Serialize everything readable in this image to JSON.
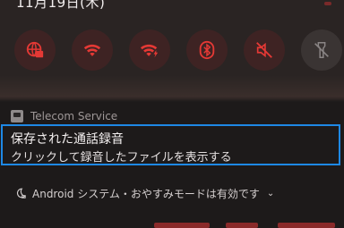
{
  "status": {
    "date": "11月19日(木)"
  },
  "quick_settings": {
    "tiles": [
      {
        "name": "ethernet",
        "state": "on",
        "icon": "ethernet-globe-icon",
        "color": "#e53935"
      },
      {
        "name": "wifi",
        "state": "on",
        "icon": "wifi-icon",
        "color": "#e53935"
      },
      {
        "name": "wifi-calling",
        "state": "on",
        "icon": "wifi-calling-icon",
        "color": "#e53935"
      },
      {
        "name": "bluetooth",
        "state": "on",
        "icon": "bluetooth-icon",
        "color": "#e53935"
      },
      {
        "name": "sound",
        "state": "on",
        "icon": "volume-muted-icon",
        "color": "#e53935"
      },
      {
        "name": "flashlight",
        "state": "off",
        "icon": "flashlight-off-icon",
        "color": "#8a8585"
      }
    ]
  },
  "notification": {
    "app_name": "Telecom Service",
    "title": "保存された通話録音",
    "text": "クリックして録音したファイルを表示する",
    "accent_color": "#1e88e5"
  },
  "dnd_banner": {
    "text": "Android システム・おやすみモードは有効です",
    "chevron": "⌄"
  }
}
